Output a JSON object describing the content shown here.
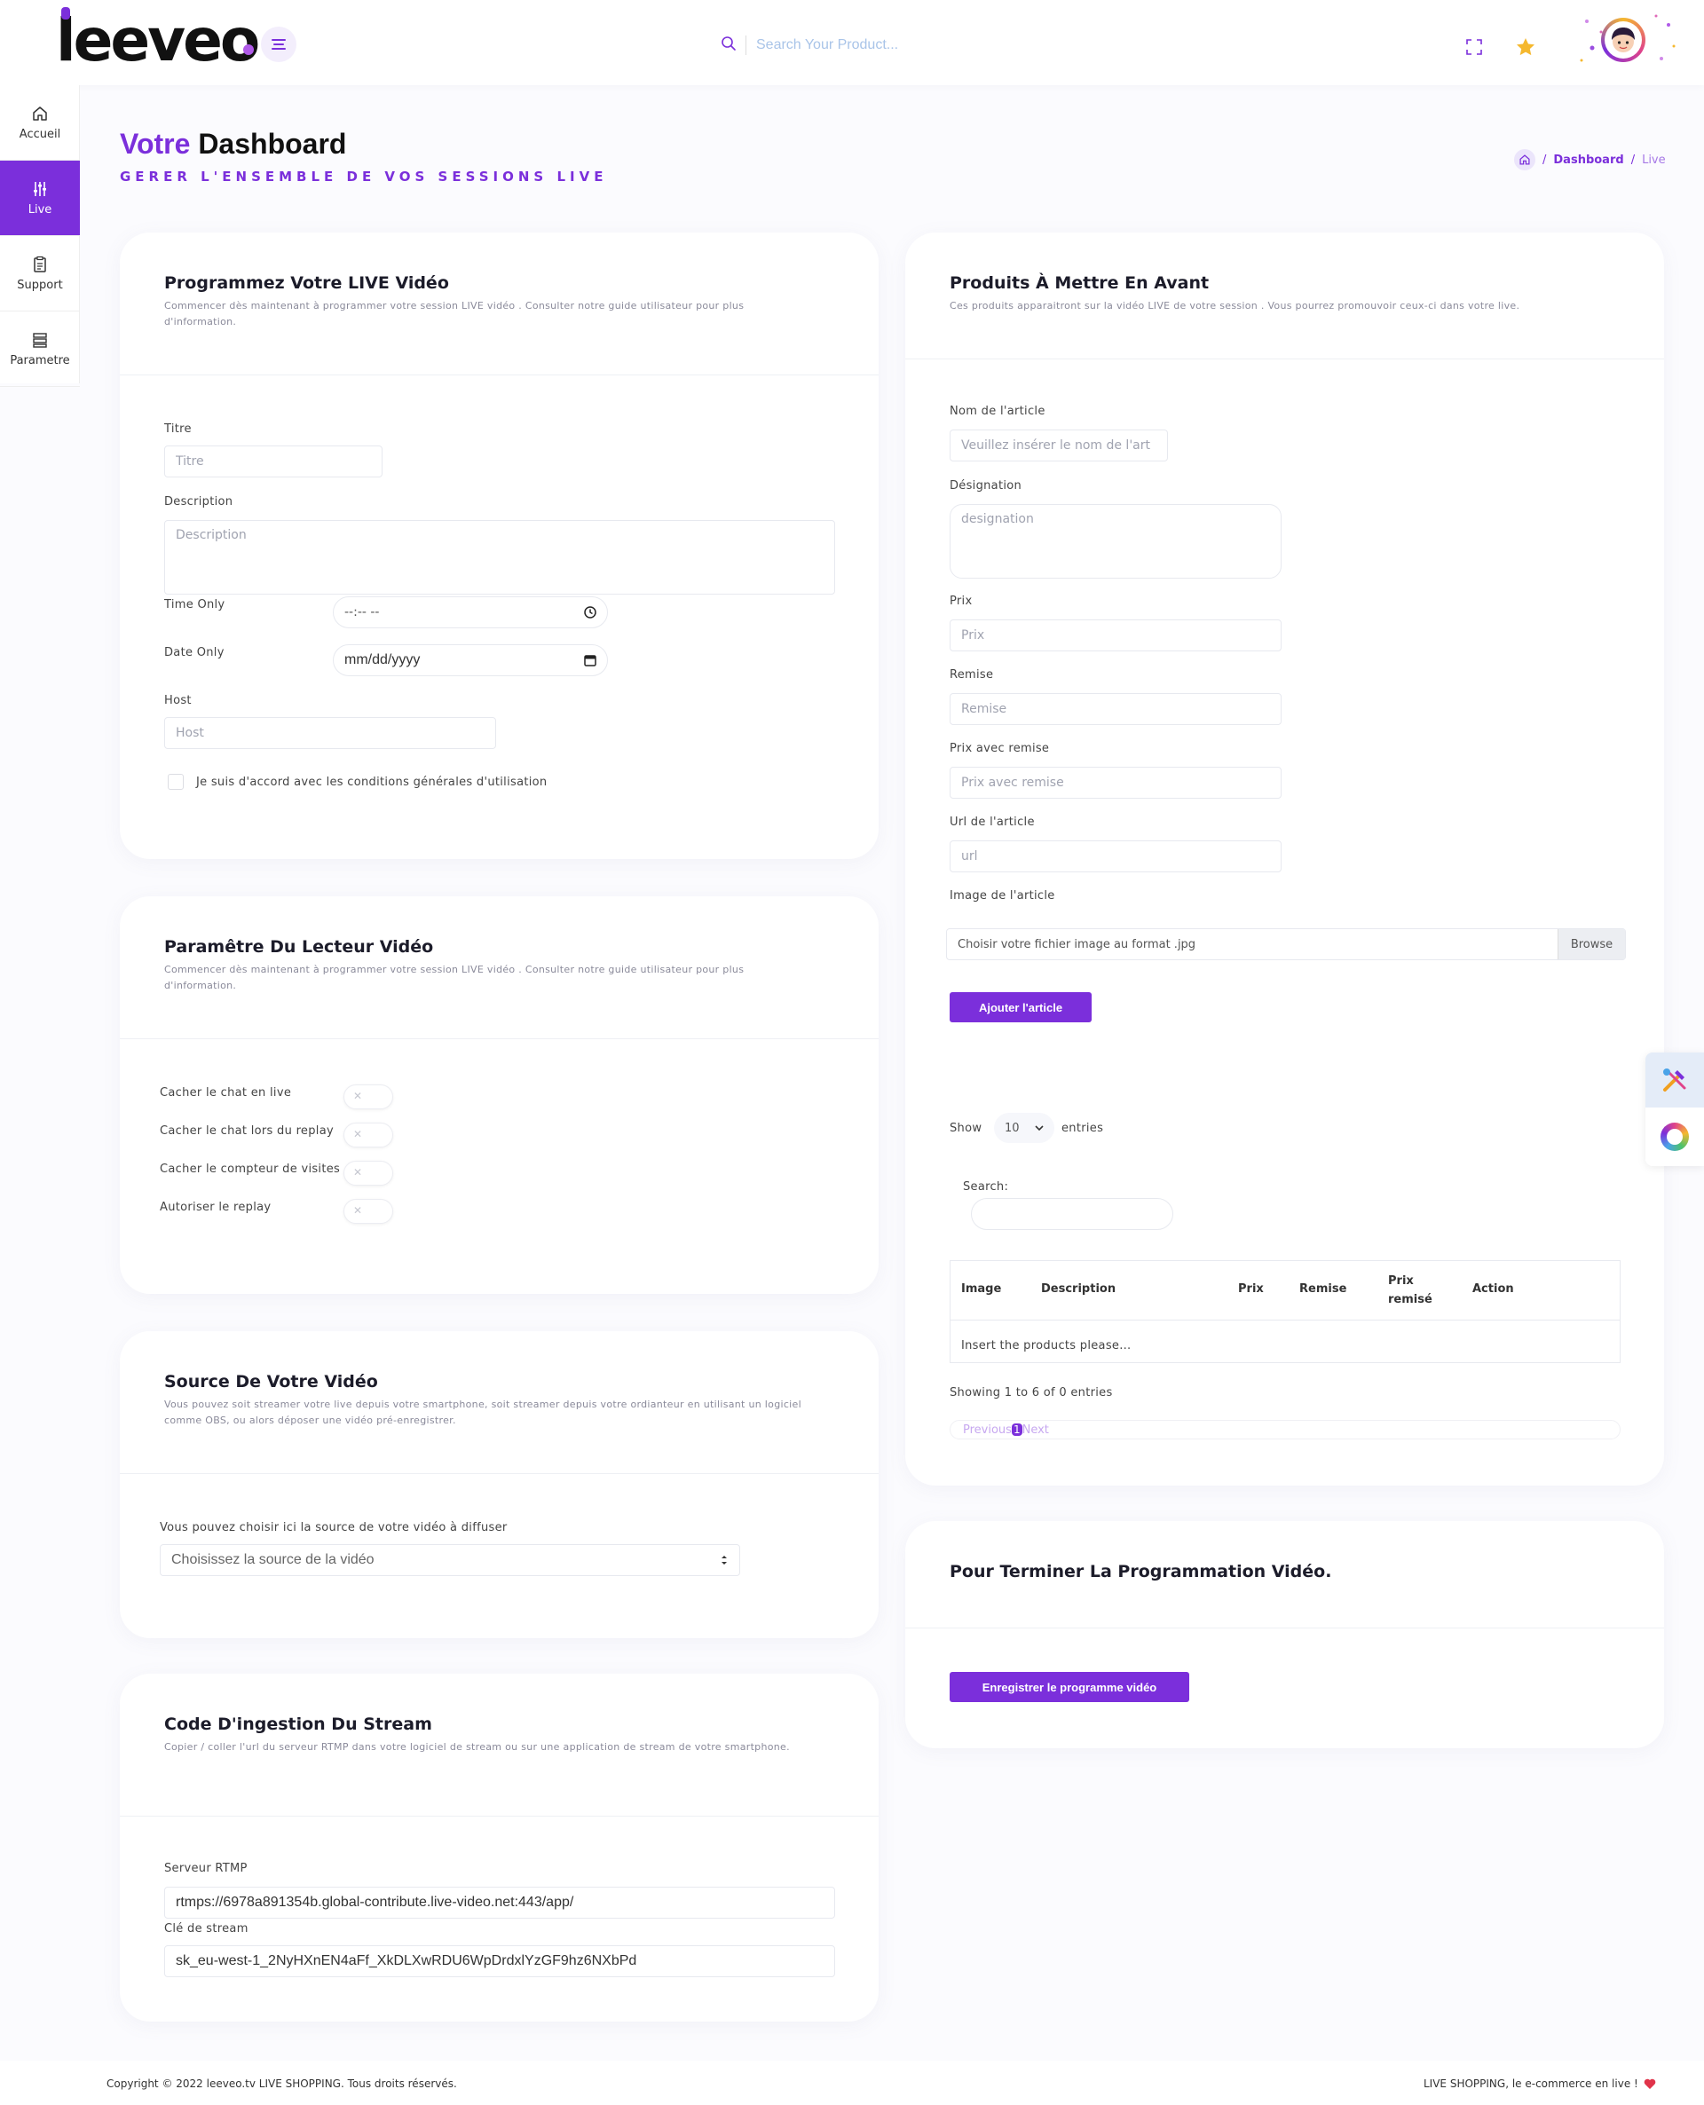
{
  "header": {
    "logo_text": "leeveo",
    "search_placeholder": "Search Your Product..."
  },
  "sidebar": {
    "items": [
      {
        "label": "Accueil",
        "icon": "home-icon"
      },
      {
        "label": "Live",
        "icon": "sliders-icon",
        "active": true
      },
      {
        "label": "Support",
        "icon": "clipboard-icon"
      },
      {
        "label": "Parametre",
        "icon": "settings-icon"
      }
    ]
  },
  "page": {
    "title_accent": "Votre",
    "title_main": "Dashboard",
    "subtitle": "GERER L'ENSEMBLE DE VOS SESSIONS LIVE",
    "breadcrumb": {
      "dashboard": "Dashboard",
      "sep": "/",
      "current": "Live"
    }
  },
  "program_card": {
    "title": "Programmez Votre LIVE Vidéo",
    "desc": "Commencer dès maintenant à programmer votre session LIVE vidéo . Consulter notre guide utilisateur pour plus d'information.",
    "title_label": "Titre",
    "title_placeholder": "Titre",
    "description_label": "Description",
    "description_placeholder": "Description",
    "time_label": "Time Only",
    "time_value": "--:-- --",
    "date_label": "Date Only",
    "date_value": "mm/dd/yyyy",
    "host_label": "Host",
    "host_placeholder": "Host",
    "terms_label": "Je suis d'accord avec les conditions générales d'utilisation"
  },
  "player_card": {
    "title": "Paramêtre Du Lecteur Vidéo",
    "desc": "Commencer dès maintenant à programmer votre session LIVE vidéo . Consulter notre guide utilisateur pour plus d'information.",
    "toggles": [
      {
        "label": "Cacher le chat en live",
        "on": false
      },
      {
        "label": "Cacher le chat lors du replay",
        "on": false
      },
      {
        "label": "Cacher le compteur de visites",
        "on": false
      },
      {
        "label": "Autoriser le replay",
        "on": false
      }
    ]
  },
  "source_card": {
    "title": "Source De Votre Vidéo",
    "desc": "Vous pouvez soit streamer votre live depuis votre smartphone, soit streamer depuis votre ordianteur en utilisant un logiciel comme OBS, ou alors déposer une vidéo pré-enregistrer.",
    "select_label": "Vous pouvez choisir ici la source de votre vidéo à diffuser",
    "select_value": "Choisissez la source de la vidéo"
  },
  "ingest_card": {
    "title": "Code D'ingestion Du Stream",
    "desc": "Copier / coller l'url du serveur RTMP dans votre logiciel de stream ou sur une application de stream de votre smartphone.",
    "rtmp_label": "Serveur RTMP",
    "rtmp_value": "rtmps://6978a891354b.global-contribute.live-video.net:443/app/",
    "key_label": "Clé de stream",
    "key_value": "sk_eu-west-1_2NyHXnEN4aFf_XkDLXwRDU6WpDrdxlYzGF9hz6NXbPd"
  },
  "products_card": {
    "title": "Produits À Mettre En Avant",
    "desc": "Ces produits apparaitront sur la vidéo LIVE de votre session . Vous pourrez promouvoir ceux-ci dans votre live.",
    "name_label": "Nom de l'article",
    "name_placeholder": "Veuillez insérer le nom de l'art",
    "designation_label": "Désignation",
    "designation_placeholder": "designation",
    "price_label": "Prix",
    "price_placeholder": "Prix",
    "discount_label": "Remise",
    "discount_placeholder": "Remise",
    "discounted_label": "Prix avec remise",
    "discounted_placeholder": "Prix avec remise",
    "url_label": "Url de l'article",
    "url_placeholder": "url",
    "image_label": "Image de l'article",
    "image_placeholder": "Choisir votre fichier image au format .jpg",
    "browse_label": "Browse",
    "add_button": "Ajouter l'article",
    "show_label": "Show",
    "show_value": "10",
    "entries_label": "entries",
    "search_label": "Search:",
    "columns": [
      "Image",
      "Description",
      "Prix",
      "Remise",
      "Prix remisé",
      "Action"
    ],
    "empty_text": "Insert the products please...",
    "info_text": "Showing 1 to 6 of 0 entries",
    "prev_label": "Previous",
    "page_label": "1",
    "next_label": "Next"
  },
  "finish_card": {
    "title": "Pour Terminer La Programmation Vidéo.",
    "button": "Enregistrer le programme vidéo"
  },
  "footer": {
    "left": "Copyright © 2022 leeveo.tv LIVE SHOPPING. Tous droits réservés.",
    "right": "LIVE SHOPPING, le e-commerce en live !"
  },
  "colors": {
    "accent": "#7b2fdb",
    "background": "#fbfbfe",
    "link": "#7b2fdb"
  }
}
